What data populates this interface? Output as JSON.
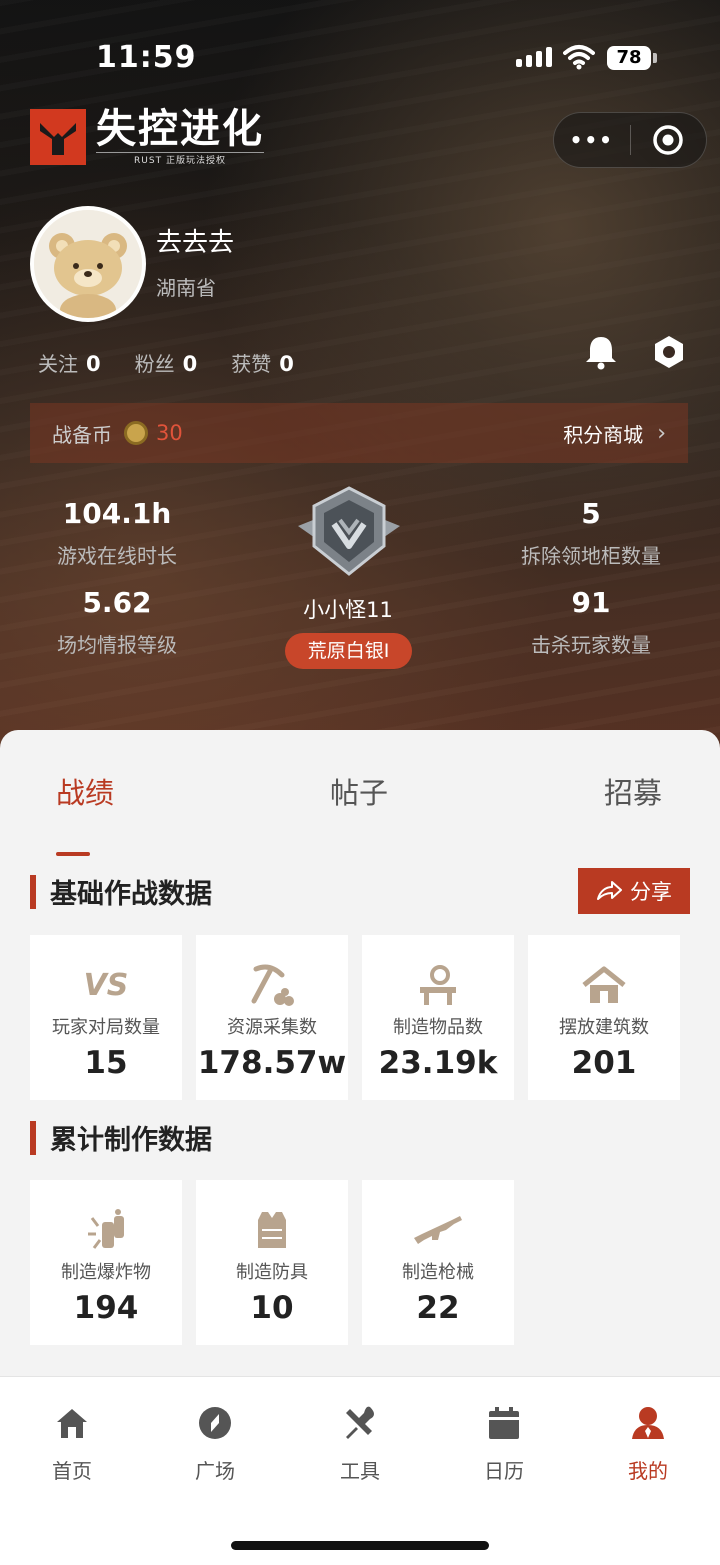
{
  "status_bar": {
    "time": "11:59",
    "battery": "78"
  },
  "logo": {
    "title": "失控进化",
    "subtitle": "RUST 正版玩法授权"
  },
  "profile": {
    "username": "去去去",
    "province": "湖南省"
  },
  "social": {
    "follow_label": "关注",
    "follow_count": "0",
    "fans_label": "粉丝",
    "fans_count": "0",
    "likes_label": "获赞",
    "likes_count": "0"
  },
  "coins": {
    "label": "战备币",
    "value": "30",
    "shop_label": "积分商城"
  },
  "stats": {
    "online_time_value": "104.1h",
    "online_time_label": "游戏在线时长",
    "intel_value": "5.62",
    "intel_label": "场均情报等级",
    "cabinet_value": "5",
    "cabinet_label": "拆除领地柜数量",
    "kills_value": "91",
    "kills_label": "击杀玩家数量",
    "player_name": "小小怪11",
    "rank": "荒原白银I"
  },
  "tabs": [
    "战绩",
    "帖子",
    "招募"
  ],
  "sections": {
    "basic_title": "基础作战数据",
    "share_label": "分享",
    "basic_cards": [
      {
        "icon": "vs-icon",
        "label": "玩家对局数量",
        "value": "15"
      },
      {
        "icon": "pickaxe-icon",
        "label": "资源采集数",
        "value": "178.57w"
      },
      {
        "icon": "workbench-icon",
        "label": "制造物品数",
        "value": "23.19k"
      },
      {
        "icon": "house-icon",
        "label": "摆放建筑数",
        "value": "201"
      }
    ],
    "craft_title": "累计制作数据",
    "craft_cards": [
      {
        "icon": "explosive-icon",
        "label": "制造爆炸物",
        "value": "194"
      },
      {
        "icon": "armor-icon",
        "label": "制造防具",
        "value": "10"
      },
      {
        "icon": "rifle-icon",
        "label": "制造枪械",
        "value": "22"
      }
    ]
  },
  "nav": [
    {
      "label": "首页",
      "icon": "home-icon"
    },
    {
      "label": "广场",
      "icon": "compass-icon"
    },
    {
      "label": "工具",
      "icon": "tools-icon"
    },
    {
      "label": "日历",
      "icon": "calendar-icon"
    },
    {
      "label": "我的",
      "icon": "profile-icon"
    }
  ],
  "colors": {
    "accent": "#b93a22",
    "coin_value": "#e0533a",
    "icon_tan": "#b8a48e"
  }
}
